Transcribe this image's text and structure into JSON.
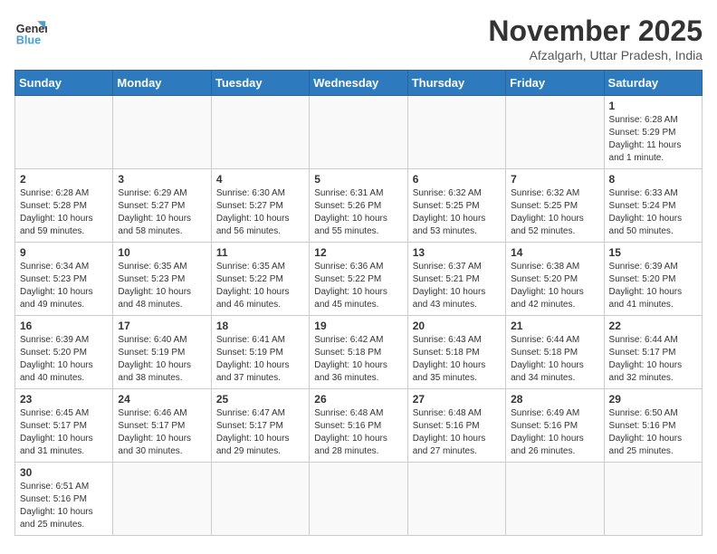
{
  "header": {
    "logo_general": "General",
    "logo_blue": "Blue",
    "month_title": "November 2025",
    "subtitle": "Afzalgarh, Uttar Pradesh, India"
  },
  "days_of_week": [
    "Sunday",
    "Monday",
    "Tuesday",
    "Wednesday",
    "Thursday",
    "Friday",
    "Saturday"
  ],
  "weeks": [
    [
      {
        "day": "",
        "info": ""
      },
      {
        "day": "",
        "info": ""
      },
      {
        "day": "",
        "info": ""
      },
      {
        "day": "",
        "info": ""
      },
      {
        "day": "",
        "info": ""
      },
      {
        "day": "",
        "info": ""
      },
      {
        "day": "1",
        "info": "Sunrise: 6:28 AM\nSunset: 5:29 PM\nDaylight: 11 hours and 1 minute."
      }
    ],
    [
      {
        "day": "2",
        "info": "Sunrise: 6:28 AM\nSunset: 5:28 PM\nDaylight: 10 hours and 59 minutes."
      },
      {
        "day": "3",
        "info": "Sunrise: 6:29 AM\nSunset: 5:27 PM\nDaylight: 10 hours and 58 minutes."
      },
      {
        "day": "4",
        "info": "Sunrise: 6:30 AM\nSunset: 5:27 PM\nDaylight: 10 hours and 56 minutes."
      },
      {
        "day": "5",
        "info": "Sunrise: 6:31 AM\nSunset: 5:26 PM\nDaylight: 10 hours and 55 minutes."
      },
      {
        "day": "6",
        "info": "Sunrise: 6:32 AM\nSunset: 5:25 PM\nDaylight: 10 hours and 53 minutes."
      },
      {
        "day": "7",
        "info": "Sunrise: 6:32 AM\nSunset: 5:25 PM\nDaylight: 10 hours and 52 minutes."
      },
      {
        "day": "8",
        "info": "Sunrise: 6:33 AM\nSunset: 5:24 PM\nDaylight: 10 hours and 50 minutes."
      }
    ],
    [
      {
        "day": "9",
        "info": "Sunrise: 6:34 AM\nSunset: 5:23 PM\nDaylight: 10 hours and 49 minutes."
      },
      {
        "day": "10",
        "info": "Sunrise: 6:35 AM\nSunset: 5:23 PM\nDaylight: 10 hours and 48 minutes."
      },
      {
        "day": "11",
        "info": "Sunrise: 6:35 AM\nSunset: 5:22 PM\nDaylight: 10 hours and 46 minutes."
      },
      {
        "day": "12",
        "info": "Sunrise: 6:36 AM\nSunset: 5:22 PM\nDaylight: 10 hours and 45 minutes."
      },
      {
        "day": "13",
        "info": "Sunrise: 6:37 AM\nSunset: 5:21 PM\nDaylight: 10 hours and 43 minutes."
      },
      {
        "day": "14",
        "info": "Sunrise: 6:38 AM\nSunset: 5:20 PM\nDaylight: 10 hours and 42 minutes."
      },
      {
        "day": "15",
        "info": "Sunrise: 6:39 AM\nSunset: 5:20 PM\nDaylight: 10 hours and 41 minutes."
      }
    ],
    [
      {
        "day": "16",
        "info": "Sunrise: 6:39 AM\nSunset: 5:20 PM\nDaylight: 10 hours and 40 minutes."
      },
      {
        "day": "17",
        "info": "Sunrise: 6:40 AM\nSunset: 5:19 PM\nDaylight: 10 hours and 38 minutes."
      },
      {
        "day": "18",
        "info": "Sunrise: 6:41 AM\nSunset: 5:19 PM\nDaylight: 10 hours and 37 minutes."
      },
      {
        "day": "19",
        "info": "Sunrise: 6:42 AM\nSunset: 5:18 PM\nDaylight: 10 hours and 36 minutes."
      },
      {
        "day": "20",
        "info": "Sunrise: 6:43 AM\nSunset: 5:18 PM\nDaylight: 10 hours and 35 minutes."
      },
      {
        "day": "21",
        "info": "Sunrise: 6:44 AM\nSunset: 5:18 PM\nDaylight: 10 hours and 34 minutes."
      },
      {
        "day": "22",
        "info": "Sunrise: 6:44 AM\nSunset: 5:17 PM\nDaylight: 10 hours and 32 minutes."
      }
    ],
    [
      {
        "day": "23",
        "info": "Sunrise: 6:45 AM\nSunset: 5:17 PM\nDaylight: 10 hours and 31 minutes."
      },
      {
        "day": "24",
        "info": "Sunrise: 6:46 AM\nSunset: 5:17 PM\nDaylight: 10 hours and 30 minutes."
      },
      {
        "day": "25",
        "info": "Sunrise: 6:47 AM\nSunset: 5:17 PM\nDaylight: 10 hours and 29 minutes."
      },
      {
        "day": "26",
        "info": "Sunrise: 6:48 AM\nSunset: 5:16 PM\nDaylight: 10 hours and 28 minutes."
      },
      {
        "day": "27",
        "info": "Sunrise: 6:48 AM\nSunset: 5:16 PM\nDaylight: 10 hours and 27 minutes."
      },
      {
        "day": "28",
        "info": "Sunrise: 6:49 AM\nSunset: 5:16 PM\nDaylight: 10 hours and 26 minutes."
      },
      {
        "day": "29",
        "info": "Sunrise: 6:50 AM\nSunset: 5:16 PM\nDaylight: 10 hours and 25 minutes."
      }
    ],
    [
      {
        "day": "30",
        "info": "Sunrise: 6:51 AM\nSunset: 5:16 PM\nDaylight: 10 hours and 25 minutes."
      },
      {
        "day": "",
        "info": ""
      },
      {
        "day": "",
        "info": ""
      },
      {
        "day": "",
        "info": ""
      },
      {
        "day": "",
        "info": ""
      },
      {
        "day": "",
        "info": ""
      },
      {
        "day": "",
        "info": ""
      }
    ]
  ]
}
